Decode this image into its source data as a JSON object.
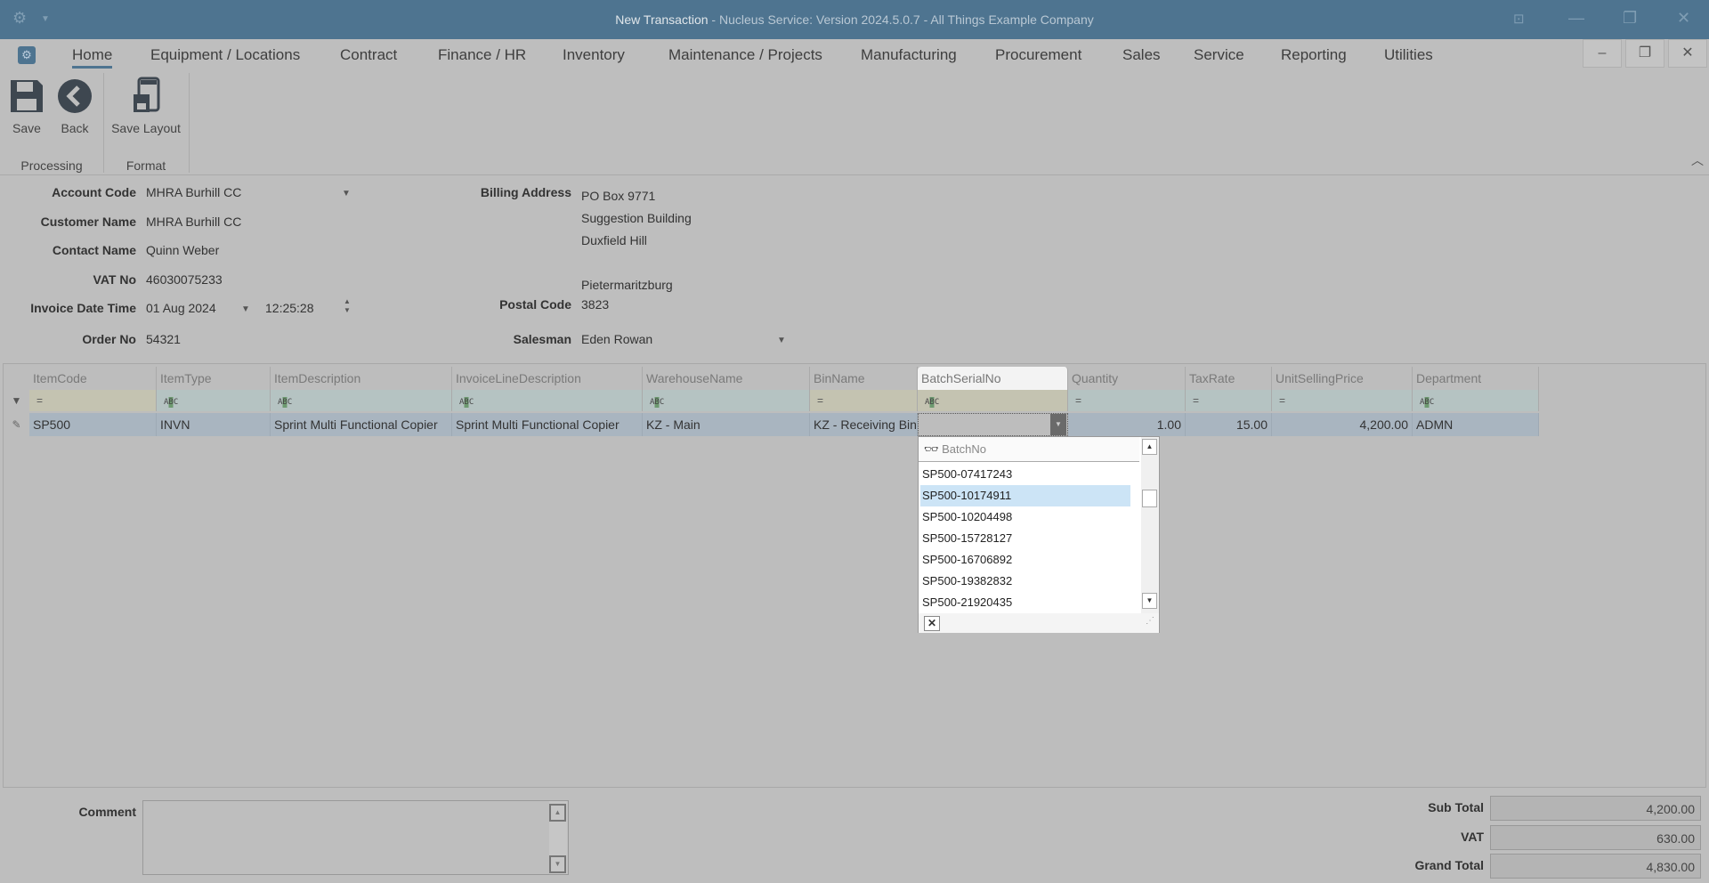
{
  "window": {
    "title_main": "New Transaction",
    "title_rest": " - Nucleus Service: Version 2024.5.0.7 - All Things Example Company"
  },
  "menu": {
    "tabs": [
      "Home",
      "Equipment / Locations",
      "Contract",
      "Finance / HR",
      "Inventory",
      "Maintenance / Projects",
      "Manufacturing",
      "Procurement",
      "Sales",
      "Service",
      "Reporting",
      "Utilities"
    ]
  },
  "ribbon": {
    "save": "Save",
    "back": "Back",
    "save_layout": "Save Layout",
    "group_processing": "Processing",
    "group_format": "Format"
  },
  "form": {
    "account_code_label": "Account Code",
    "account_code": "MHRA Burhill CC",
    "customer_name_label": "Customer Name",
    "customer_name": "MHRA Burhill CC",
    "contact_name_label": "Contact Name",
    "contact_name": "Quinn Weber",
    "vat_no_label": "VAT No",
    "vat_no": "46030075233",
    "invoice_dt_label": "Invoice Date Time",
    "invoice_date": "01 Aug 2024",
    "invoice_time": "12:25:28",
    "order_no_label": "Order No",
    "order_no": "54321",
    "billing_address_label": "Billing Address",
    "billing_address": [
      "PO Box 9771",
      "Suggestion Building",
      "Duxfield Hill",
      "",
      "Pietermaritzburg"
    ],
    "postal_code_label": "Postal Code",
    "postal_code": "3823",
    "salesman_label": "Salesman",
    "salesman": "Eden Rowan"
  },
  "grid": {
    "columns": [
      "ItemCode",
      "ItemType",
      "ItemDescription",
      "InvoiceLineDescription",
      "WarehouseName",
      "BinName",
      "BatchSerialNo",
      "Quantity",
      "TaxRate",
      "UnitSellingPrice",
      "Department"
    ],
    "filter_eq": "=",
    "filter_abc": "ABC",
    "row": [
      "SP500",
      "INVN",
      "Sprint Multi Functional Copier",
      "Sprint Multi Functional Copier",
      "KZ - Main",
      "KZ - Receiving Bin",
      "",
      "1.00",
      "15.00",
      "4,200.00",
      "ADMN"
    ]
  },
  "batch_popup": {
    "search_placeholder": "BatchNo",
    "items": [
      "SP500-07417243",
      "SP500-10174911",
      "SP500-10204498",
      "SP500-15728127",
      "SP500-16706892",
      "SP500-19382832",
      "SP500-21920435"
    ],
    "selected_index": 1
  },
  "footer": {
    "comment_label": "Comment",
    "comment": "",
    "sub_total_label": "Sub Total",
    "sub_total": "4,200.00",
    "vat_label": "VAT",
    "vat": "630.00",
    "grand_total_label": "Grand Total",
    "grand_total": "4,830.00"
  }
}
